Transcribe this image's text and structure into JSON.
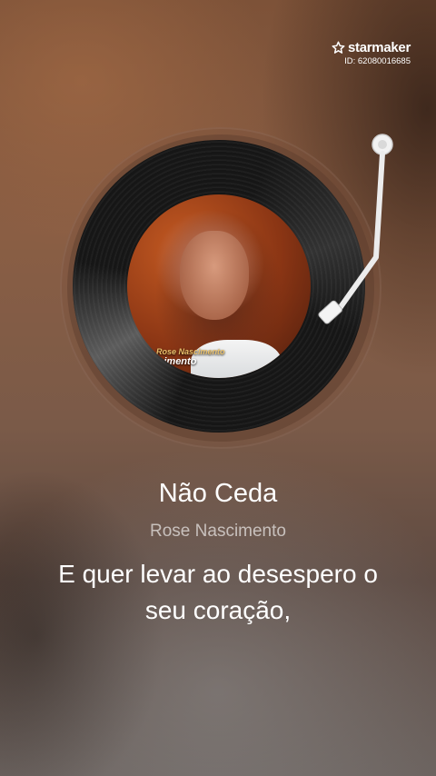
{
  "brand": {
    "name": "starmaker",
    "id_text": "ID: 62080016685",
    "icon": "star-icon"
  },
  "album_art": {
    "overlay_text_line1": "Rose Nascimento",
    "overlay_text_line2": "ascimento"
  },
  "song": {
    "title": "Não Ceda",
    "artist": "Rose Nascimento"
  },
  "lyrics": {
    "line1": "E quer levar ao desespero o",
    "line2": "seu coração,"
  },
  "colors": {
    "text_primary": "#ffffff",
    "text_secondary": "#c9b9ae",
    "vinyl": "#161616",
    "tonearm": "#e8e8e8"
  }
}
